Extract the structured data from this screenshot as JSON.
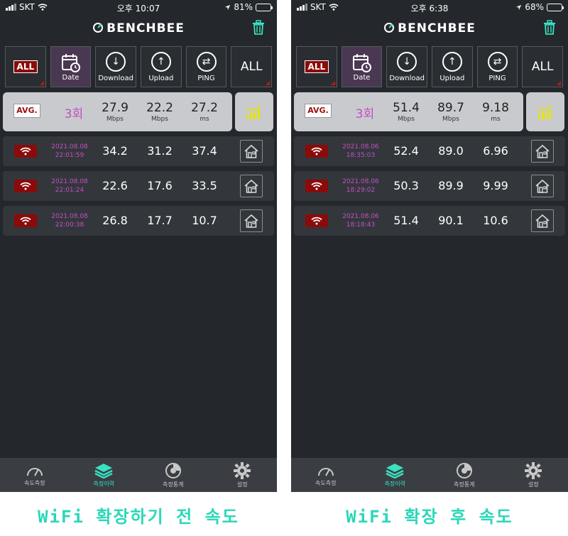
{
  "colors": {
    "accent": "#3ae0c0",
    "wifi_red": "#8b0a0a",
    "date_purple": "#c44ec4",
    "bg": "#24272b"
  },
  "phones": [
    {
      "status": {
        "carrier": "SKT",
        "time": "오후 10:07",
        "battery": "81%",
        "battery_level": 0.81
      },
      "brand": "BENCHBEE",
      "filters": {
        "all_tag": "ALL",
        "date": "Date",
        "download": "Download",
        "upload": "Upload",
        "ping": "PING",
        "all_right": "ALL"
      },
      "avg": {
        "badge": "AVG.",
        "count": "3회",
        "download": "27.9",
        "download_unit": "Mbps",
        "upload": "22.2",
        "upload_unit": "Mbps",
        "ping": "27.2",
        "ping_unit": "ms"
      },
      "rows": [
        {
          "date": "2021.08.08",
          "time": "22:01:59",
          "download": "34.2",
          "upload": "31.2",
          "ping": "37.4"
        },
        {
          "date": "2021.08.08",
          "time": "22:01:24",
          "download": "22.6",
          "upload": "17.6",
          "ping": "33.5"
        },
        {
          "date": "2021.08.08",
          "time": "22:00:38",
          "download": "26.8",
          "upload": "17.7",
          "ping": "10.7"
        }
      ],
      "tabs": {
        "speed": "속도측정",
        "history": "측정이력",
        "stats": "측정통계",
        "settings": "설정"
      },
      "caption": "WiFi 확장하기 전 속도"
    },
    {
      "status": {
        "carrier": "SKT",
        "time": "오후 6:38",
        "battery": "68%",
        "battery_level": 0.68
      },
      "brand": "BENCHBEE",
      "filters": {
        "all_tag": "ALL",
        "date": "Date",
        "download": "Download",
        "upload": "Upload",
        "ping": "PING",
        "all_right": "ALL"
      },
      "avg": {
        "badge": "AVG.",
        "count": "3회",
        "download": "51.4",
        "download_unit": "Mbps",
        "upload": "89.7",
        "upload_unit": "Mbps",
        "ping": "9.18",
        "ping_unit": "ms"
      },
      "rows": [
        {
          "date": "2021.08.06",
          "time": "18:35:03",
          "download": "52.4",
          "upload": "89.0",
          "ping": "6.96"
        },
        {
          "date": "2021.08.06",
          "time": "18:29:02",
          "download": "50.3",
          "upload": "89.9",
          "ping": "9.99"
        },
        {
          "date": "2021.08.06",
          "time": "18:18:43",
          "download": "51.4",
          "upload": "90.1",
          "ping": "10.6"
        }
      ],
      "tabs": {
        "speed": "속도측정",
        "history": "측정이력",
        "stats": "측정통계",
        "settings": "설정"
      },
      "caption": "WiFi 확장 후 속도"
    }
  ]
}
